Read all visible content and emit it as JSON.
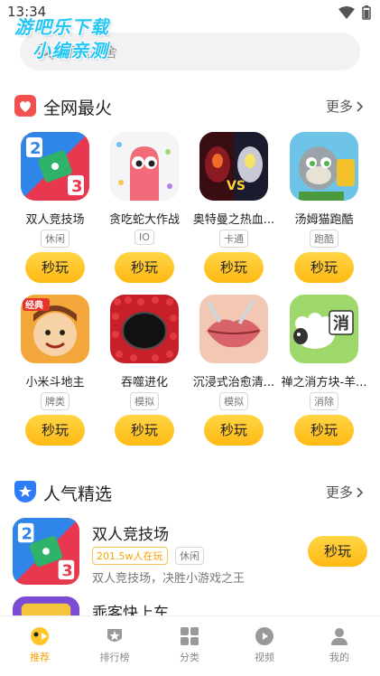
{
  "status": {
    "time": "13:34"
  },
  "watermark": {
    "line1": "游吧乐下载",
    "line2": "小编亲测"
  },
  "search": {
    "placeholder": "猛鬼宿舍"
  },
  "section_hot": {
    "title": "全网最火",
    "more": "更多"
  },
  "hot_apps": [
    {
      "name": "双人竞技场",
      "tag": "休闲",
      "button": "秒玩"
    },
    {
      "name": "贪吃蛇大作战",
      "tag": "IO",
      "button": "秒玩"
    },
    {
      "name": "奥特曼之热血...",
      "tag": "卡通",
      "button": "秒玩"
    },
    {
      "name": "汤姆猫跑酷",
      "tag": "跑酷",
      "button": "秒玩"
    },
    {
      "name": "小米斗地主",
      "tag": "牌类",
      "button": "秒玩"
    },
    {
      "name": "吞噬进化",
      "tag": "模拟",
      "button": "秒玩"
    },
    {
      "name": "沉浸式治愈清...",
      "tag": "模拟",
      "button": "秒玩"
    },
    {
      "name": "禅之消方块-羊...",
      "tag": "消除",
      "button": "秒玩"
    }
  ],
  "section_pop": {
    "title": "人气精选",
    "more": "更多"
  },
  "popular": [
    {
      "name": "双人竞技场",
      "online": "201.5w人在玩",
      "tag": "休闲",
      "desc": "双人竞技场，决胜小游戏之王",
      "button": "秒玩"
    },
    {
      "name": "乖客快上车",
      "online": "",
      "tag": "",
      "desc": "",
      "button": ""
    }
  ],
  "tabs": [
    {
      "label": "推荐",
      "icon": "recommend-icon",
      "active": true
    },
    {
      "label": "排行榜",
      "icon": "ranking-icon",
      "active": false
    },
    {
      "label": "分类",
      "icon": "category-icon",
      "active": false
    },
    {
      "label": "视频",
      "icon": "video-icon",
      "active": false
    },
    {
      "label": "我的",
      "icon": "profile-icon",
      "active": false
    }
  ],
  "colors": {
    "accent": "#f5a300",
    "button": "#ffc62a",
    "hot_badge": "#f2514f",
    "pop_badge": "#2f7df6"
  }
}
